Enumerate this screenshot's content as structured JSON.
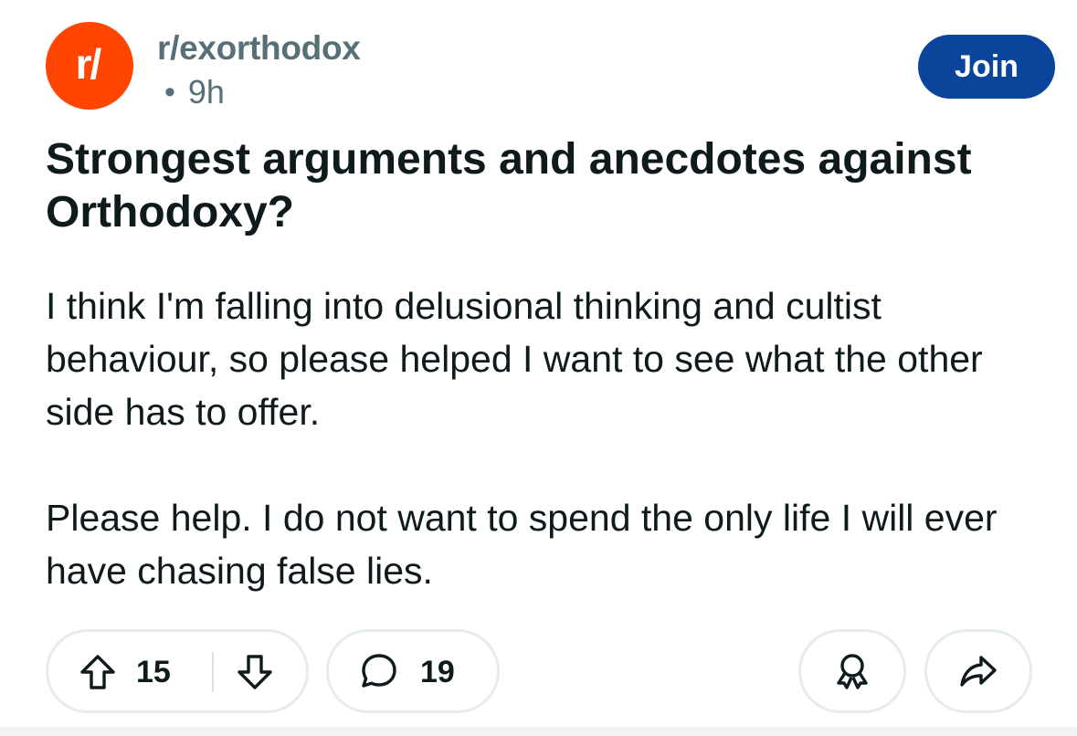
{
  "post": {
    "subreddit": "r/exorthodox",
    "avatar_text": "r/",
    "meta_dot": "•",
    "age": "9h",
    "join_label": "Join",
    "title": "Strongest arguments and anecdotes against Orthodoxy?",
    "body_paragraphs": [
      "I think I'm falling into delusional thinking and cultist behaviour, so please helped I want to see what the other side has to offer.",
      "Please help. I do not want to spend the only life I will ever have chasing false lies."
    ]
  },
  "actions": {
    "upvote_count": "15",
    "comment_count": "19",
    "icons": {
      "upvote": "arrow-up-icon",
      "downvote": "arrow-down-icon",
      "comment": "speech-bubble-icon",
      "award": "award-ribbon-icon",
      "share": "share-arrow-icon"
    }
  },
  "colors": {
    "brand_orange": "#ff4500",
    "join_blue": "#0a449b",
    "meta_gray": "#576f76",
    "pill_border": "#e5ebee",
    "text": "#0f1a1c"
  }
}
